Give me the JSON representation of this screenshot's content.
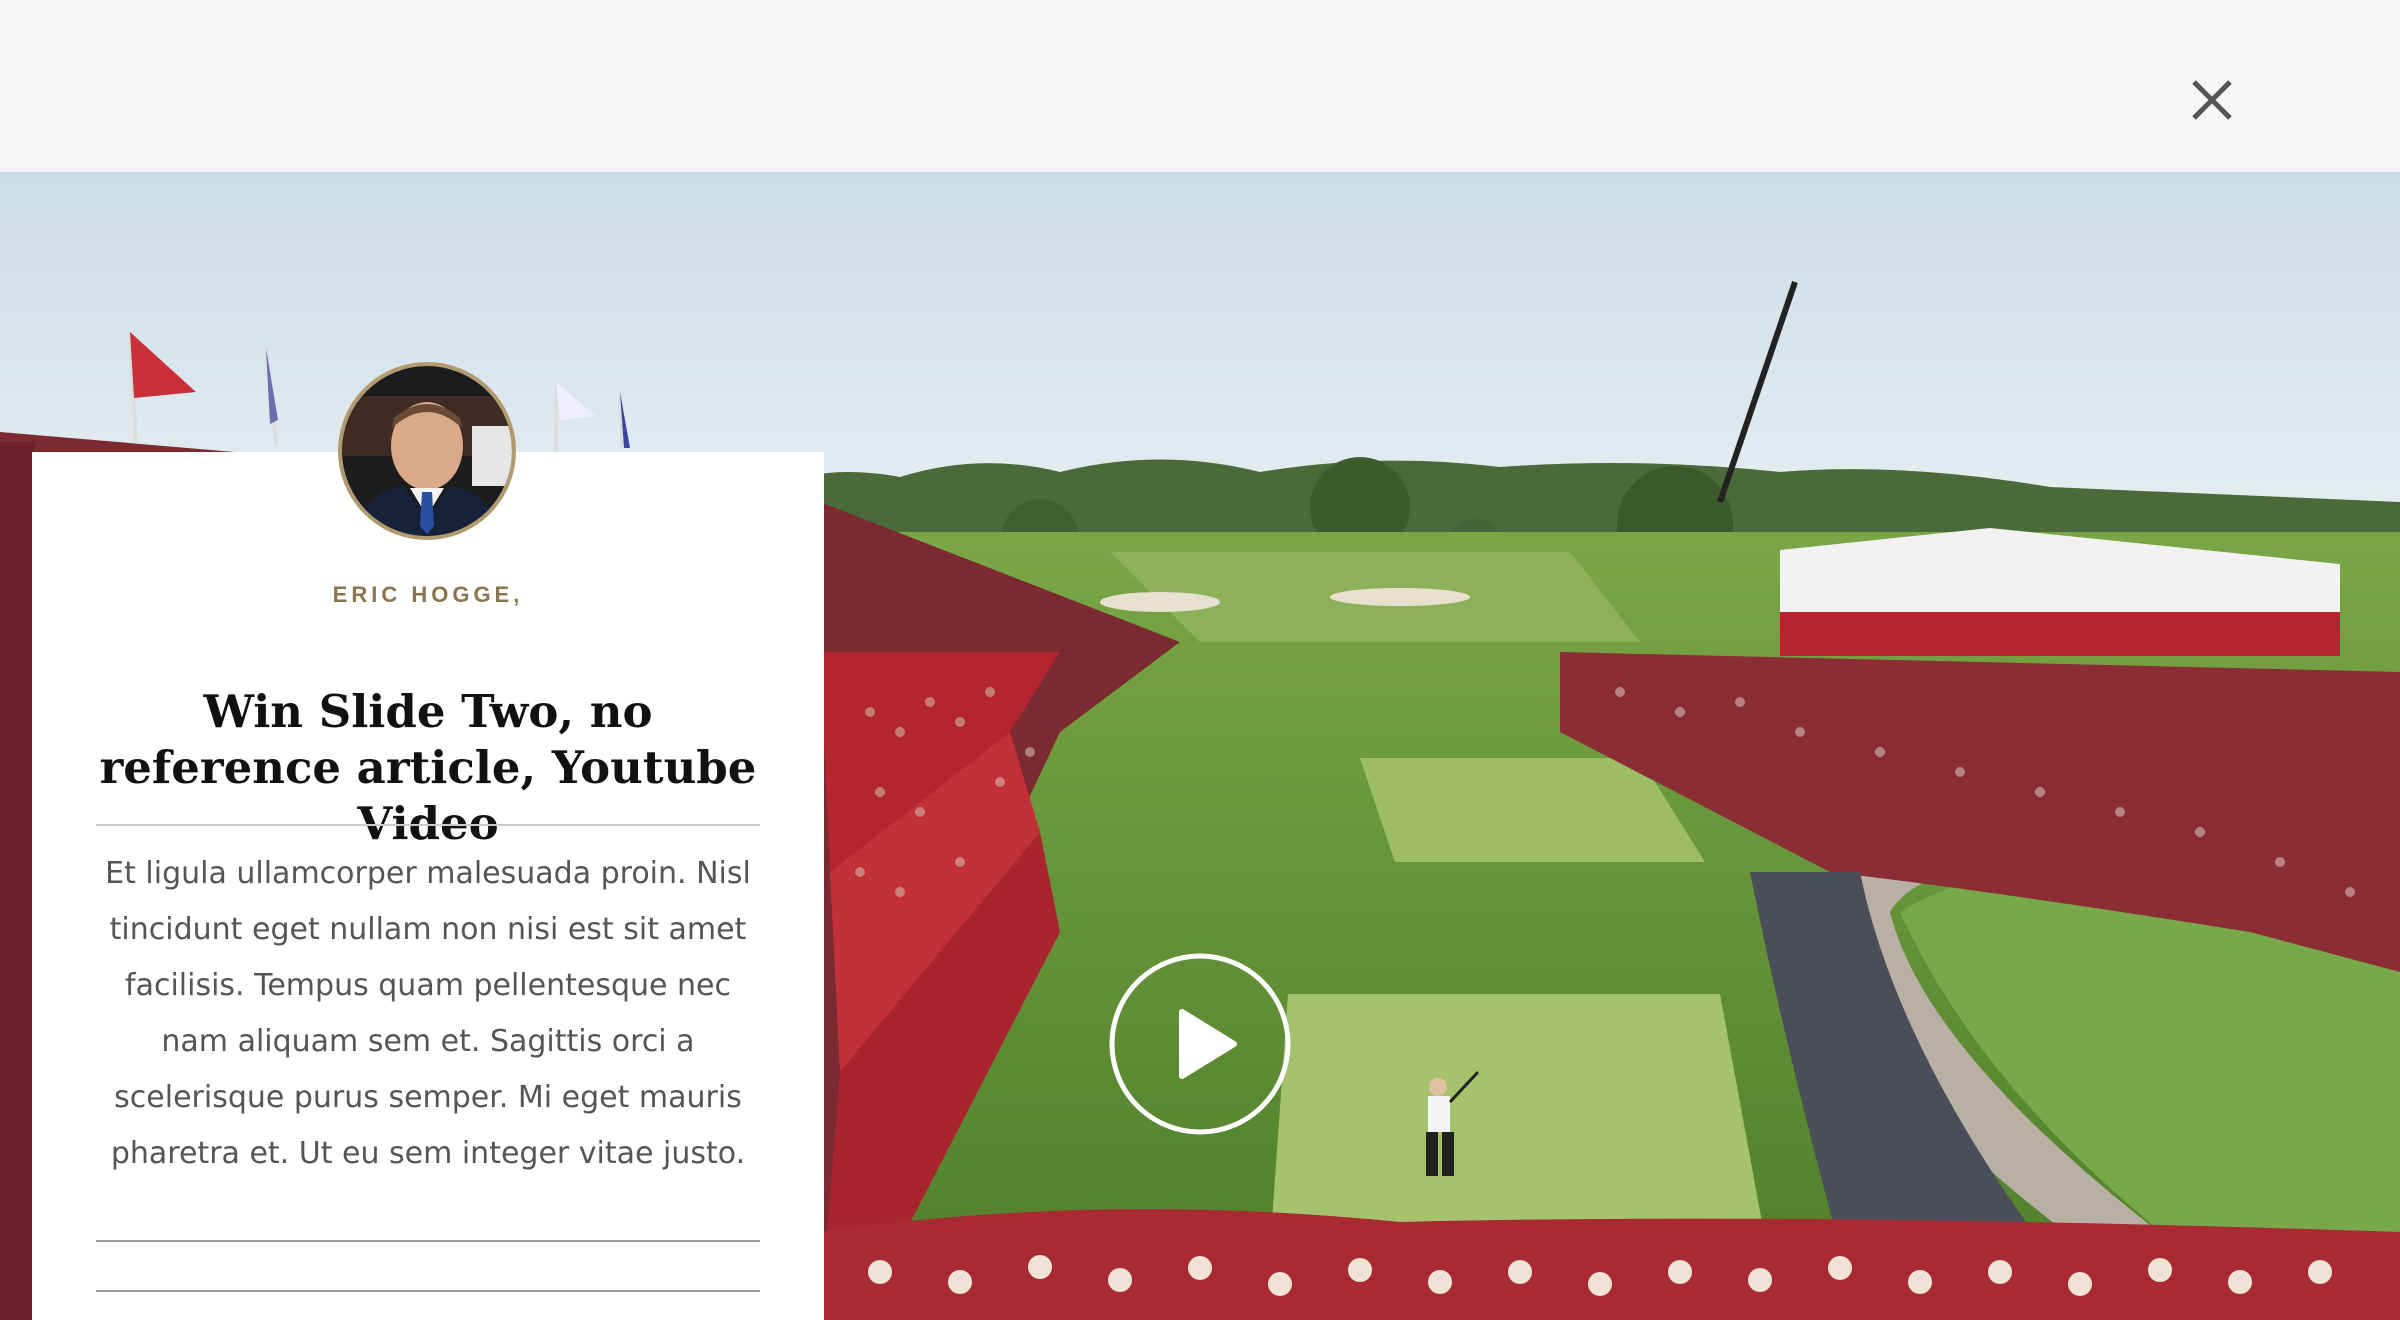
{
  "header": {
    "close_icon": "close-icon"
  },
  "hero": {
    "play_icon": "play-icon",
    "colors": {
      "sky": "#cfe0ec",
      "grass": "#6f9a3c",
      "crowd_red": "#b3262f",
      "tent_white": "#f2f2f2"
    }
  },
  "card": {
    "avatar_icon": "author-avatar",
    "author": "ERIC HOGGE,",
    "title": "Win Slide Two, no reference article, Youtube Video",
    "body": "Et ligula ullamcorper malesuada proin. Nisl tincidunt eget nullam non nisi est sit amet facilisis. Tempus quam pellentesque nec nam aliquam sem et. Sagittis orci a scelerisque purus semper. Mi eget mauris pharetra et. Ut eu sem integer vitae justo.",
    "accent_color": "#8b7550"
  }
}
